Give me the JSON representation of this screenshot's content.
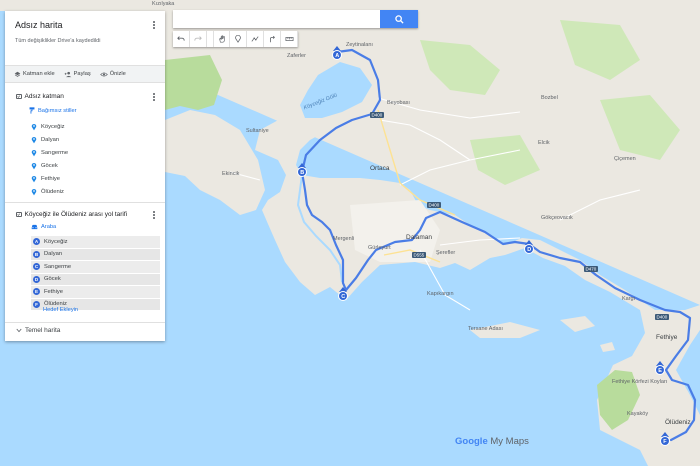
{
  "panel": {
    "title": "Adsız harita",
    "subtitle": "Tüm değişiklikler Drive'a kaydedildi",
    "actions": {
      "add_layer": "Katman ekle",
      "share": "Paylaş",
      "preview": "Önizle"
    }
  },
  "layer1": {
    "name": "Adsız katman",
    "style_link": "Bağımsız stiller",
    "items": [
      "Köyceğiz",
      "Dalyan",
      "Sarıgerme",
      "Göcek",
      "Fethiye",
      "Ölüdeniz"
    ]
  },
  "layer2": {
    "name": "Köyceğiz ile Ölüdeniz arası yol tarifi",
    "mode": "Araba",
    "stops": [
      {
        "letter": "A",
        "name": "Köyceğiz"
      },
      {
        "letter": "B",
        "name": "Dalyan"
      },
      {
        "letter": "C",
        "name": "Sarıgerme"
      },
      {
        "letter": "D",
        "name": "Göcek"
      },
      {
        "letter": "E",
        "name": "Fethiye"
      },
      {
        "letter": "F",
        "name": "Ölüdeniz"
      }
    ],
    "add_destination": "Hedef Ekleyin"
  },
  "base_map": {
    "label": "Temel harita"
  },
  "search": {
    "placeholder": ""
  },
  "map": {
    "places": {
      "kizilyaka": "Kızılyaka",
      "zaferler": "Zaferler",
      "zeytinalani": "Zeytinalanı",
      "beyobasi": "Beyobası",
      "bozbel": "Bozbel",
      "sultaniye": "Sultaniye",
      "ekincik": "Ekincik",
      "ortaca": "Ortaca",
      "elcik": "Elcik",
      "ciciemen": "Çiçemen",
      "gokceovacik": "Gökçeovacık",
      "mergenli": "Mergenli",
      "gurleyurt": "Gürleyurt",
      "dalaman": "Dalaman",
      "sereflер": "Şerefler",
      "kargi": "Kargı",
      "kapikargin": "Kapıkargın",
      "tersane_adasi": "Tersane Adası",
      "fethiye": "Fethiye",
      "fethiye_koylari": "Fethiye Körfezi Koyları",
      "kayakoy": "Kayaköy",
      "oludeniz": "Ölüdeniz",
      "koycegiz_lake": "Köyceğiz Gölü",
      "kocm": "Kö",
      "sar": "S",
      "rme": "rme",
      "ocek": "k",
      "gul": "G"
    },
    "roads": {
      "d400a": "D400",
      "d400b": "D400",
      "d400c": "D400",
      "d555": "D555",
      "d470": "D470"
    },
    "markers": [
      "A",
      "B",
      "C",
      "D",
      "E",
      "F"
    ],
    "logo_google": "Google",
    "logo_mymaps": "My Maps"
  },
  "colors": {
    "route": "#4a7de6",
    "marker": "#3367d6",
    "land": "#ebe8e1",
    "water": "#aadaff",
    "forest": "#b8dc9c"
  }
}
